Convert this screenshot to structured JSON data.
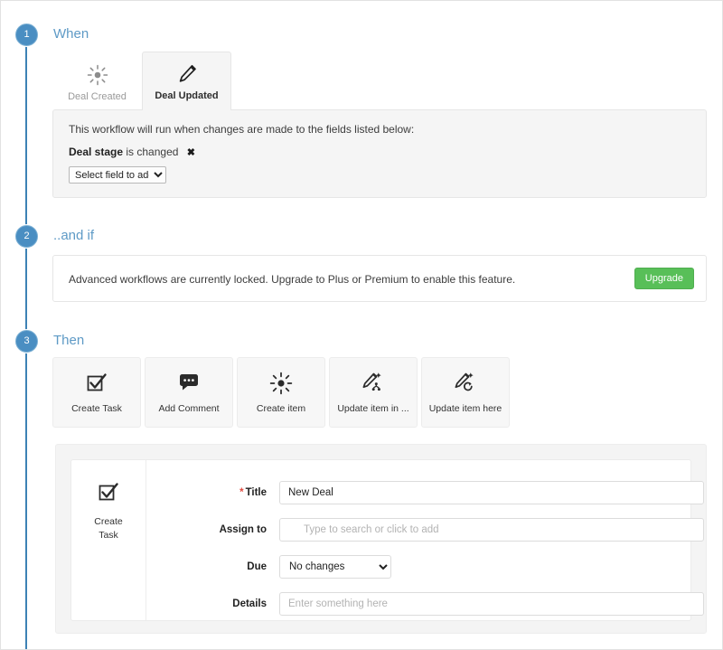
{
  "steps": [
    {
      "number": "1",
      "title": "When"
    },
    {
      "number": "2",
      "title": "..and if"
    },
    {
      "number": "3",
      "title": "Then"
    }
  ],
  "when": {
    "tabs": [
      {
        "label": "Deal Created",
        "icon": "sun-burst-icon",
        "active": false
      },
      {
        "label": "Deal Updated",
        "icon": "pencil-icon",
        "active": true
      }
    ],
    "description": "This workflow will run when changes are made to the fields listed below:",
    "condition": {
      "field": "Deal stage",
      "operator": "is changed",
      "remove_icon": "close-x-icon"
    },
    "add_field_select": {
      "value": "Select field to add",
      "options": [
        "Select field to add"
      ]
    }
  },
  "and_if": {
    "message": "Advanced workflows are currently locked. Upgrade to Plus or Premium to enable this feature.",
    "upgrade_label": "Upgrade",
    "upgrade_color": "#58bf58"
  },
  "then": {
    "actions": [
      {
        "label": "Create Task",
        "icon": "checkbox-checked-icon"
      },
      {
        "label": "Add Comment",
        "icon": "comment-bubble-icon"
      },
      {
        "label": "Create item",
        "icon": "sun-burst-icon"
      },
      {
        "label": "Update item in ...",
        "icon": "pencil-hierarchy-icon"
      },
      {
        "label": "Update item here",
        "icon": "pencil-refresh-icon"
      }
    ],
    "form": {
      "side_icon": "checkbox-checked-icon",
      "side_label_line1": "Create",
      "side_label_line2": "Task",
      "fields": [
        {
          "label": "Title",
          "required": true,
          "type": "text",
          "value": "New Deal",
          "placeholder": ""
        },
        {
          "label": "Assign to",
          "required": false,
          "type": "search",
          "value": "",
          "placeholder": "Type to search or click to add",
          "icon": "magnifier-icon"
        },
        {
          "label": "Due",
          "required": false,
          "type": "select",
          "value": "No changes",
          "options": [
            "No changes"
          ]
        },
        {
          "label": "Details",
          "required": false,
          "type": "text",
          "value": "",
          "placeholder": "Enter something here"
        }
      ]
    }
  },
  "theme": {
    "accent_blue": "#4a8ec2",
    "heading_blue": "#5e9ac6",
    "rail_blue": "#3d82b5",
    "required_red": "#e04a3f"
  }
}
